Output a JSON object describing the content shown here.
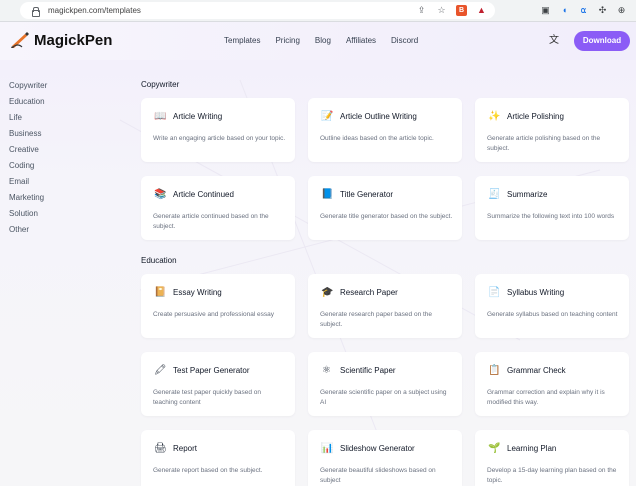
{
  "browser": {
    "url": "magickpen.com/templates"
  },
  "header": {
    "brand": "MagickPen",
    "nav": [
      "Templates",
      "Pricing",
      "Blog",
      "Affiliates",
      "Discord"
    ],
    "download_label": "Download",
    "accent_color": "#8b5cf6"
  },
  "sidebar": {
    "items": [
      "Copywriter",
      "Education",
      "Life",
      "Business",
      "Creative",
      "Coding",
      "Email",
      "Marketing",
      "Solution",
      "Other"
    ]
  },
  "sections": [
    {
      "title": "Copywriter",
      "cards": [
        {
          "icon": "book-icon",
          "glyph": "📖",
          "title": "Article Writing",
          "desc": "Write an engaging article based on your topic."
        },
        {
          "icon": "memo-icon",
          "glyph": "📝",
          "title": "Article Outline Writing",
          "desc": "Outline ideas based on the article topic."
        },
        {
          "icon": "sparkles-icon",
          "glyph": "✨",
          "title": "Article Polishing",
          "desc": "Generate article polishing based on the subject."
        },
        {
          "icon": "books-icon",
          "glyph": "📚",
          "title": "Article Continued",
          "desc": "Generate article continued based on the subject."
        },
        {
          "icon": "document-icon",
          "glyph": "📘",
          "title": "Title Generator",
          "desc": "Generate title generator based on the subject."
        },
        {
          "icon": "layers-icon",
          "glyph": "🧾",
          "title": "Summarize",
          "desc": "Summarize the following text into 100 words"
        }
      ]
    },
    {
      "title": "Education",
      "cards": [
        {
          "icon": "notebook-icon",
          "glyph": "📔",
          "title": "Essay Writing",
          "desc": "Create persuasive and professional essay"
        },
        {
          "icon": "graduation-cap-icon",
          "glyph": "🎓",
          "title": "Research Paper",
          "desc": "Generate research paper based on the subject."
        },
        {
          "icon": "page-icon",
          "glyph": "📄",
          "title": "Syllabus Writing",
          "desc": "Generate syllabus based on teaching content"
        },
        {
          "icon": "crayon-icon",
          "glyph": "🖍",
          "title": "Test Paper Generator",
          "desc": "Generate test paper quickly based on teaching content"
        },
        {
          "icon": "atom-icon",
          "glyph": "⚛",
          "title": "Scientific Paper",
          "desc": "Generate scientific paper on a subject using AI"
        },
        {
          "icon": "clipboard-icon",
          "glyph": "📋",
          "title": "Grammar Check",
          "desc": "Grammar correction and explain why it is modified this way."
        },
        {
          "icon": "printer-icon",
          "glyph": "🖨",
          "title": "Report",
          "desc": "Generate report based on the subject."
        },
        {
          "icon": "slideshow-icon",
          "glyph": "📊",
          "title": "Slideshow Generator",
          "desc": "Generate beautiful slideshows based on subject"
        },
        {
          "icon": "plant-icon",
          "glyph": "🌱",
          "title": "Learning Plan",
          "desc": "Develop a 15-day learning plan based on the topic."
        }
      ]
    }
  ]
}
